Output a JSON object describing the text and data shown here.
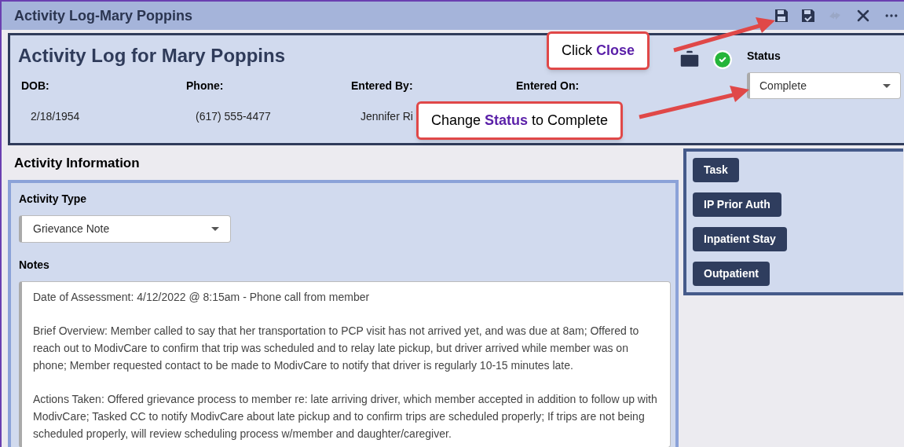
{
  "window": {
    "title": "Activity Log-Mary Poppins"
  },
  "toolbar": [
    {
      "kind": "save",
      "disabled": false
    },
    {
      "kind": "save_check",
      "disabled": false
    },
    {
      "kind": "sync",
      "disabled": true
    },
    {
      "kind": "close",
      "disabled": false
    },
    {
      "kind": "more",
      "disabled": false
    }
  ],
  "header": {
    "title": "Activity Log for Mary Poppins",
    "status": {
      "label": "Status",
      "value": "Complete"
    },
    "fields": [
      {
        "label": "DOB:",
        "value": "2/18/1954"
      },
      {
        "label": "Phone:",
        "value": "(617) 555-4477"
      },
      {
        "label": "Entered By:",
        "value": "Jennifer Ri"
      },
      {
        "label": "Entered On:"
      }
    ]
  },
  "activity": {
    "heading": "Activity Information",
    "type_label": "Activity Type",
    "type_value": "Grievance Note",
    "notes_label": "Notes",
    "notes": [
      "Date of Assessment: 4/12/2022 @ 8:15am - Phone call from member",
      "Brief Overview: Member called to say that her transportation to PCP visit has not arrived yet, and was due at 8am; Offered to reach out to ModivCare to confirm that trip was scheduled and to relay late pickup, but driver arrived while member was on phone; Member requested contact to be made to ModivCare to notify that driver is regularly 10-15 minutes late.",
      "Actions Taken: Offered grievance process to member re: late arriving driver, which member accepted in addition to follow up with ModivCare; Tasked CC to notify ModivCare about late pickup and to confirm trips are scheduled properly; If trips are not being scheduled properly, will review scheduling process w/member and daughter/caregiver."
    ]
  },
  "actions": [
    "Task",
    "IP Prior Auth",
    "Inpatient Stay",
    "Outpatient"
  ],
  "callouts": [
    {
      "text": "Click **Close**"
    },
    {
      "text": "Change **Status** to Complete"
    }
  ]
}
